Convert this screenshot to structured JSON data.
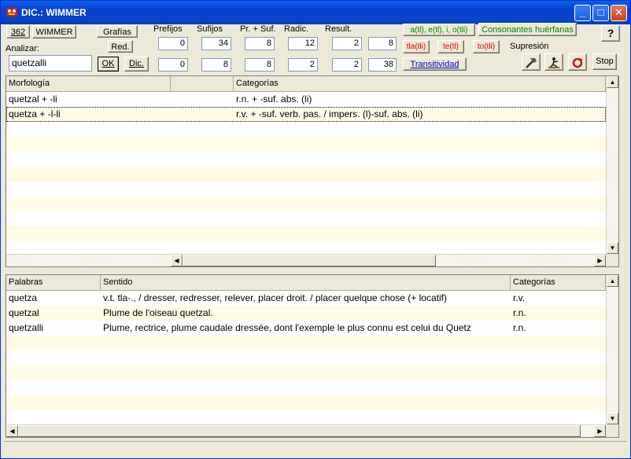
{
  "window": {
    "title": "DIC.: WIMMER",
    "minimize": "_",
    "maximize": "□",
    "close": "✕"
  },
  "toolbar": {
    "count_button": "362",
    "dict_button": "WIMMER",
    "grafias_button": "Grafías",
    "red_button": "Red.",
    "analyze_label": "Analizar:",
    "analyze_value": "quetzalli",
    "ok_button": "OK",
    "dic_button": "Dic.",
    "help_button": "?"
  },
  "counters": {
    "headers": [
      "Prefijos",
      "Sufijos",
      "Pr. + Suf.",
      "Radic.",
      "Result."
    ],
    "row1": [
      "0",
      "34",
      "8",
      "12",
      "2",
      "8"
    ],
    "row2": [
      "0",
      "8",
      "8",
      "2",
      "2",
      "38"
    ]
  },
  "options": {
    "aeio": "a(tl), e(tl), i, o(tli)",
    "consonantes": "Consonantes huérfanas",
    "tla": "tla(tli)",
    "te": "te(tl)",
    "to": "to(tli)",
    "transitividad": "Transitividad",
    "supresion_label": "Supresión",
    "stop_button": "Stop"
  },
  "morph_table": {
    "columns": [
      "Morfología",
      "",
      "Categorías"
    ],
    "rows": [
      {
        "morph": "quetzal + -li",
        "cat": "r.n. + -suf. abs. (li)"
      },
      {
        "morph": "quetza + -l-li",
        "cat": "r.v. + -suf. verb. pas. / impers. (l)-suf. abs. (li)"
      }
    ]
  },
  "word_table": {
    "columns": [
      "Palabras",
      "Sentido",
      "Categorías"
    ],
    "rows": [
      {
        "word": "quetza",
        "sense": "v.t. tla-.,   /  dresser, redresser, relever, placer droit.  /  placer quelque chose (+ locatif)",
        "cat": "r.v."
      },
      {
        "word": "quetzal",
        "sense": "Plume de l'oiseau quetzal.",
        "cat": "r.n."
      },
      {
        "word": "quetzalli",
        "sense": "Plume, rectrice, plume caudale dressée, dont l'exemple le plus connu est celui du Quetz",
        "cat": "r.n."
      }
    ]
  }
}
